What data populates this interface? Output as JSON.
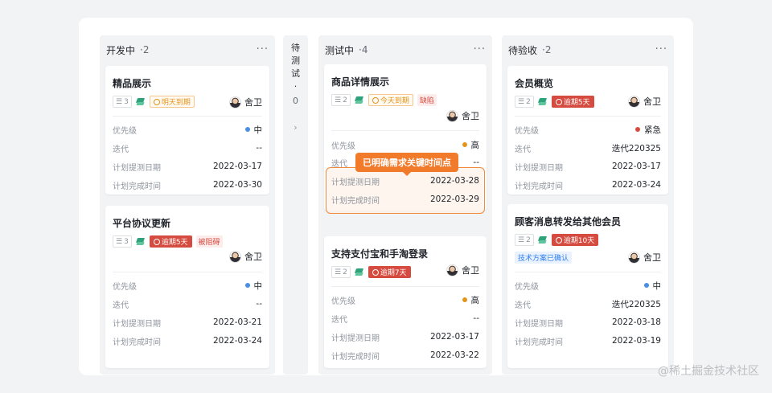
{
  "columns": {
    "dev": {
      "title": "开发中",
      "count": "·2",
      "cards": [
        {
          "title": "精品展示",
          "sub_count": "3",
          "due": "明天到期",
          "assignee": "舍卫",
          "fields": [
            {
              "label": "优先级",
              "value": "中",
              "dot": "#4a90e2"
            },
            {
              "label": "迭代",
              "value": "--"
            },
            {
              "label": "计划提测日期",
              "value": "2022-03-17"
            },
            {
              "label": "计划完成时间",
              "value": "2022-03-30"
            }
          ]
        },
        {
          "title": "平台协议更新",
          "sub_count": "3",
          "due": "逾期5天",
          "label": "被阻碍",
          "assignee": "舍卫",
          "fields": [
            {
              "label": "优先级",
              "value": "中",
              "dot": "#4a90e2"
            },
            {
              "label": "迭代",
              "value": "--"
            },
            {
              "label": "计划提测日期",
              "value": "2022-03-21"
            },
            {
              "label": "计划完成时间",
              "value": "2022-03-24"
            }
          ]
        }
      ]
    },
    "pending": {
      "chars": [
        "待",
        "测",
        "试",
        "·",
        "0"
      ],
      "chevron": "›"
    },
    "testing": {
      "title": "测试中",
      "count": "·4",
      "cards": [
        {
          "title": "商品详情展示",
          "sub_count": "2",
          "due": "今天到期",
          "label": "缺陷",
          "assignee": "舍卫",
          "fields": [
            {
              "label": "优先级",
              "value": "高",
              "dot": "#e5941a"
            },
            {
              "label": "迭代",
              "value": "--"
            },
            {
              "label": "计划提测日期",
              "value": "2022-03-28"
            },
            {
              "label": "计划完成时间",
              "value": "2022-03-29"
            }
          ]
        },
        {
          "title": "支持支付宝和手淘登录",
          "sub_count": "2",
          "due": "逾期7天",
          "assignee": "舍卫",
          "fields": [
            {
              "label": "优先级",
              "value": "高",
              "dot": "#e5941a"
            },
            {
              "label": "迭代",
              "value": "--"
            },
            {
              "label": "计划提测日期",
              "value": "2022-03-17"
            },
            {
              "label": "计划完成时间",
              "value": "2022-03-22"
            }
          ]
        }
      ],
      "tooltip": "已明确需求关键时间点"
    },
    "accept": {
      "title": "待验收",
      "count": "·2",
      "cards": [
        {
          "title": "会员概览",
          "sub_count": "2",
          "due": "逾期5天",
          "assignee": "舍卫",
          "fields": [
            {
              "label": "优先级",
              "value": "紧急",
              "dot": "#d64b3f"
            },
            {
              "label": "迭代",
              "value": "迭代220325"
            },
            {
              "label": "计划提测日期",
              "value": "2022-03-17"
            },
            {
              "label": "计划完成时间",
              "value": "2022-03-24"
            }
          ]
        },
        {
          "title": "顾客消息转发给其他会员",
          "sub_count": "2",
          "due": "逾期10天",
          "label": "技术方案已确认",
          "assignee": "舍卫",
          "fields": [
            {
              "label": "优先级",
              "value": "中",
              "dot": "#4a90e2"
            },
            {
              "label": "迭代",
              "value": "迭代220325"
            },
            {
              "label": "计划提测日期",
              "value": "2022-03-18"
            },
            {
              "label": "计划完成时间",
              "value": "2022-03-19"
            }
          ]
        }
      ]
    }
  },
  "more_label": "···",
  "watermark": "@稀土掘金技术社区"
}
